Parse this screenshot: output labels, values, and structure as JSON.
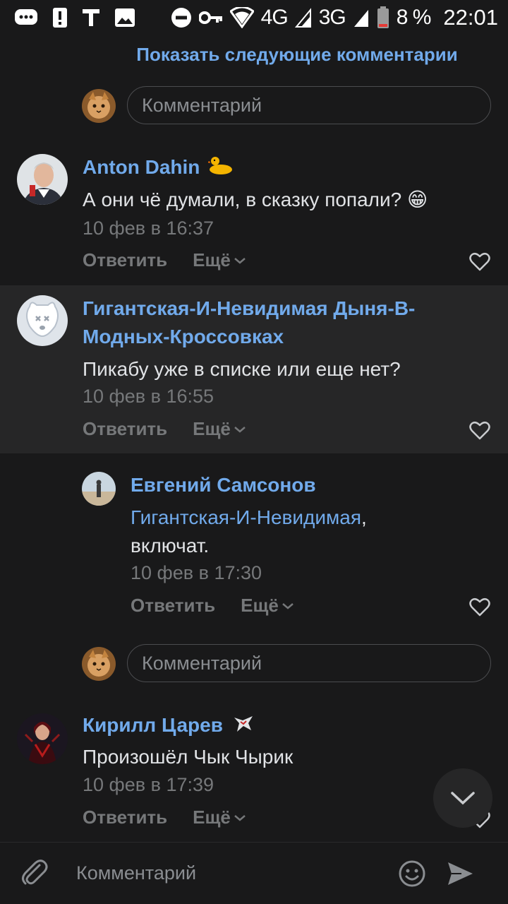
{
  "status_bar": {
    "network_4g": "4G",
    "network_3g": "3G",
    "battery": "8 %",
    "time": "22:01",
    "icons": [
      "chat-icon",
      "alert-icon",
      "text-icon",
      "image-icon",
      "dnd-icon",
      "key-icon",
      "wifi-icon",
      "signal-icon",
      "battery-icon"
    ]
  },
  "thread": {
    "show_more_label": "Показать следующие комментарии",
    "reply_input_placeholder": "Комментарий"
  },
  "comments": [
    {
      "author": "Anton Dahin",
      "badge": "duck-emoji-icon",
      "text": "А они чё думали, в сказку попали? 😁",
      "date": "10 фев в 16:37",
      "reply_label": "Ответить",
      "more_label": "Ещё"
    },
    {
      "author": "Гигантская-И-Невидимая Дыня-В-Модных-Кроссовках",
      "text": "Пикабу уже в списке или еще нет?",
      "date": "10 фев в 16:55",
      "reply_label": "Ответить",
      "more_label": "Ещё"
    },
    {
      "author": "Евгений Самсонов",
      "reply_to": "Гигантская-И-Невидимая",
      "text_suffix": ",",
      "text": "включат.",
      "date": "10 фев в 17:30",
      "reply_label": "Ответить",
      "more_label": "Ещё"
    },
    {
      "author": "Кирилл Царев",
      "badge": "virtus-pro-icon",
      "text": "Произошёл Чык Чырик",
      "date": "10 фев в 17:39",
      "reply_label": "Ответить",
      "more_label": "Ещё"
    }
  ],
  "composer": {
    "placeholder": "Комментарий"
  },
  "colors": {
    "background": "#19191a",
    "highlight": "#262627",
    "accent": "#71aaeb",
    "secondary_text": "#76787a"
  }
}
